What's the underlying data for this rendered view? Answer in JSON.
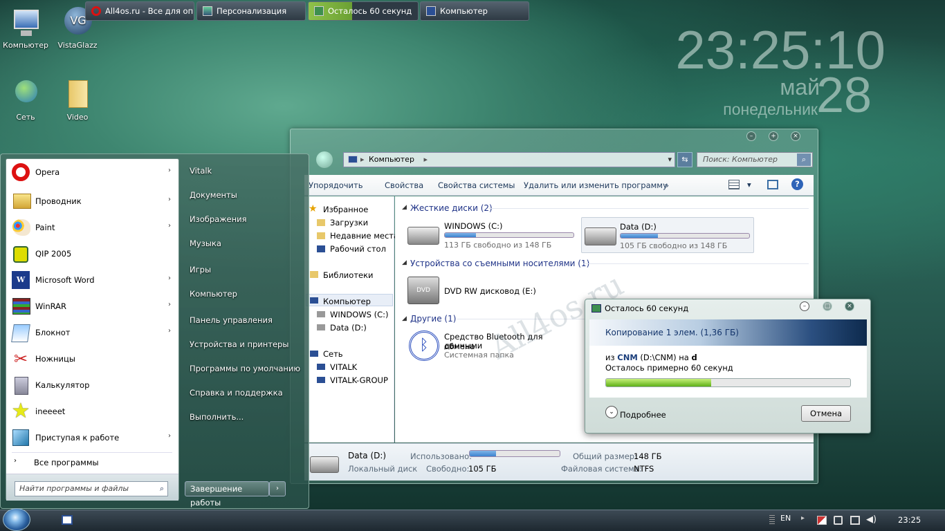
{
  "desktop": {
    "icons": [
      {
        "label": "Компьютер",
        "icon": "computer-icon"
      },
      {
        "label": "VistaGlazz",
        "icon": "vistaglazz-icon"
      },
      {
        "label": "Сеть",
        "icon": "network-icon"
      },
      {
        "label": "Video",
        "icon": "folder-icon"
      }
    ],
    "clock": {
      "time": "23:25:10",
      "month": "май",
      "day": "28",
      "weekday": "понедельник"
    },
    "watermark": "All4os.ru"
  },
  "explorer": {
    "address": "Компьютер",
    "search_placeholder": "Поиск: Компьютер",
    "toolbar": {
      "organize": "Упорядочить",
      "properties": "Свойства",
      "system_properties": "Свойства системы",
      "uninstall": "Удалить или изменить программу",
      "more": "»"
    },
    "nav": {
      "favorites": "Избранное",
      "downloads": "Загрузки",
      "recent": "Недавние места",
      "desktop": "Рабочий стол",
      "libraries": "Библиотеки",
      "computer": "Компьютер",
      "drive_c": "WINDOWS (C:)",
      "drive_d": "Data (D:)",
      "network": "Сеть",
      "net1": "VITALK",
      "net2": "VITALK-GROUP"
    },
    "groups": {
      "hdd": "Жесткие диски (2)",
      "removable": "Устройства со съемными носителями (1)",
      "other": "Другие (1)"
    },
    "drives": [
      {
        "name": "WINDOWS (C:)",
        "free": "113 ГБ свободно из 148 ГБ",
        "used_fraction": 0.24
      },
      {
        "name": "Data (D:)",
        "free": "105 ГБ свободно из 148 ГБ",
        "used_fraction": 0.29
      }
    ],
    "dvd": "DVD RW дисковод (E:)",
    "bluetooth": {
      "name1": "Средство Bluetooth для обмена",
      "name2": "данными",
      "type": "Системная папка"
    },
    "details": {
      "name": "Data (D:)",
      "type": "Локальный диск",
      "used_label": "Использовано:",
      "free_label": "Свободно:",
      "free_value": "105 ГБ",
      "total_label": "Общий размер:",
      "total_value": "148 ГБ",
      "fs_label": "Файловая система:",
      "fs_value": "NTFS",
      "used_fraction": 0.29
    }
  },
  "copy_dialog": {
    "title": "Осталось 60 секунд",
    "header": "Копирование 1 элем. (1,36 ГБ)",
    "from_prefix": "из ",
    "from_name": "CNM",
    "from_path": " (D:\\CNM) на ",
    "to": "d",
    "remaining": "Осталось примерно 60 секунд",
    "progress_fraction": 0.43,
    "more": "Подробнее",
    "cancel": "Отмена"
  },
  "start_menu": {
    "programs": [
      {
        "label": "Opera",
        "arrow": true
      },
      {
        "label": "Проводник",
        "arrow": true
      },
      {
        "label": "Paint",
        "arrow": true
      },
      {
        "label": "QIP 2005",
        "arrow": false
      },
      {
        "label": "Microsoft Word",
        "arrow": true
      },
      {
        "label": "WinRAR",
        "arrow": true
      },
      {
        "label": "Блокнот",
        "arrow": true
      },
      {
        "label": "Ножницы",
        "arrow": false
      },
      {
        "label": "Калькулятор",
        "arrow": false
      },
      {
        "label": "ineeeet",
        "arrow": false
      },
      {
        "label": "Приступая к работе",
        "arrow": true
      }
    ],
    "all_programs": "Все программы",
    "search_placeholder": "Найти программы и файлы",
    "right": [
      "Vitalk",
      "Документы",
      "Изображения",
      "Музыка",
      "Игры",
      "Компьютер",
      "Панель управления",
      "Устройства и принтеры",
      "Программы по умолчанию",
      "Справка и поддержка",
      "Выполнить..."
    ],
    "shutdown": "Завершение работы"
  },
  "taskbar": {
    "buttons": [
      "All4os.ru - Все для оп...",
      "Персонализация",
      "Осталось 60 секунд",
      "Компьютер"
    ],
    "lang": "EN",
    "time": "23:25"
  }
}
